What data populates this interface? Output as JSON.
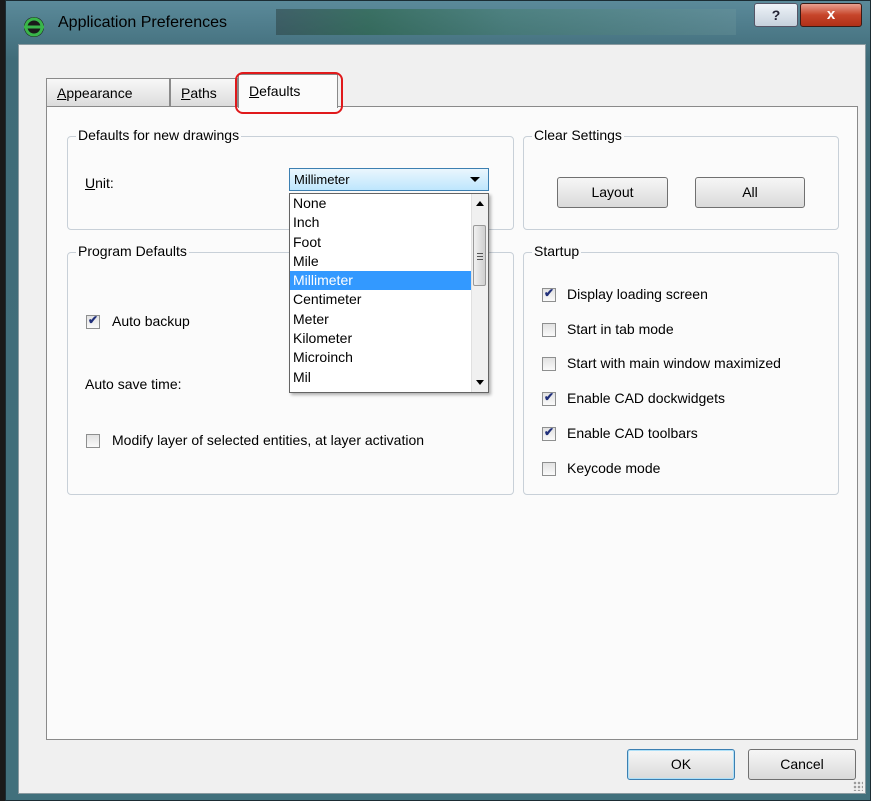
{
  "window": {
    "title": "Application Preferences",
    "help_label": "?",
    "close_label": "x"
  },
  "tabs": [
    {
      "label_u": "A",
      "label_rest": "ppearance",
      "active": false
    },
    {
      "label_u": "P",
      "label_rest": "aths",
      "active": false
    },
    {
      "label_u": "D",
      "label_rest": "efaults",
      "active": true
    }
  ],
  "defaults_group": {
    "title": "Defaults for new drawings",
    "unit_label_u": "U",
    "unit_label_rest": "nit:",
    "unit_selected": "Millimeter",
    "unit_options": [
      "None",
      "Inch",
      "Foot",
      "Mile",
      "Millimeter",
      "Centimeter",
      "Meter",
      "Kilometer",
      "Microinch",
      "Mil"
    ],
    "highlighted_option": "Millimeter"
  },
  "clear_settings": {
    "title": "Clear Settings",
    "layout_label": "Layout",
    "all_label": "All"
  },
  "program_defaults": {
    "title": "Program Defaults",
    "auto_backup": {
      "label": "Auto backup",
      "checked": true
    },
    "auto_save_label": "Auto save time:",
    "modify_layer": {
      "label": "Modify layer of selected entities, at layer activation",
      "checked": false
    }
  },
  "startup": {
    "title": "Startup",
    "options": [
      {
        "label": "Display loading screen",
        "checked": true
      },
      {
        "label": "Start in tab mode",
        "checked": false
      },
      {
        "label": "Start with main window maximized",
        "checked": false
      },
      {
        "label": "Enable CAD dockwidgets",
        "checked": true
      },
      {
        "label": "Enable CAD toolbars",
        "checked": true
      },
      {
        "label": "Keycode mode",
        "checked": false
      }
    ]
  },
  "footer": {
    "ok_label": "OK",
    "cancel_label": "Cancel"
  },
  "colors": {
    "selection": "#3399ff",
    "tab_highlight": "#e0191b"
  },
  "icons": {
    "app": "librecad-icon"
  }
}
